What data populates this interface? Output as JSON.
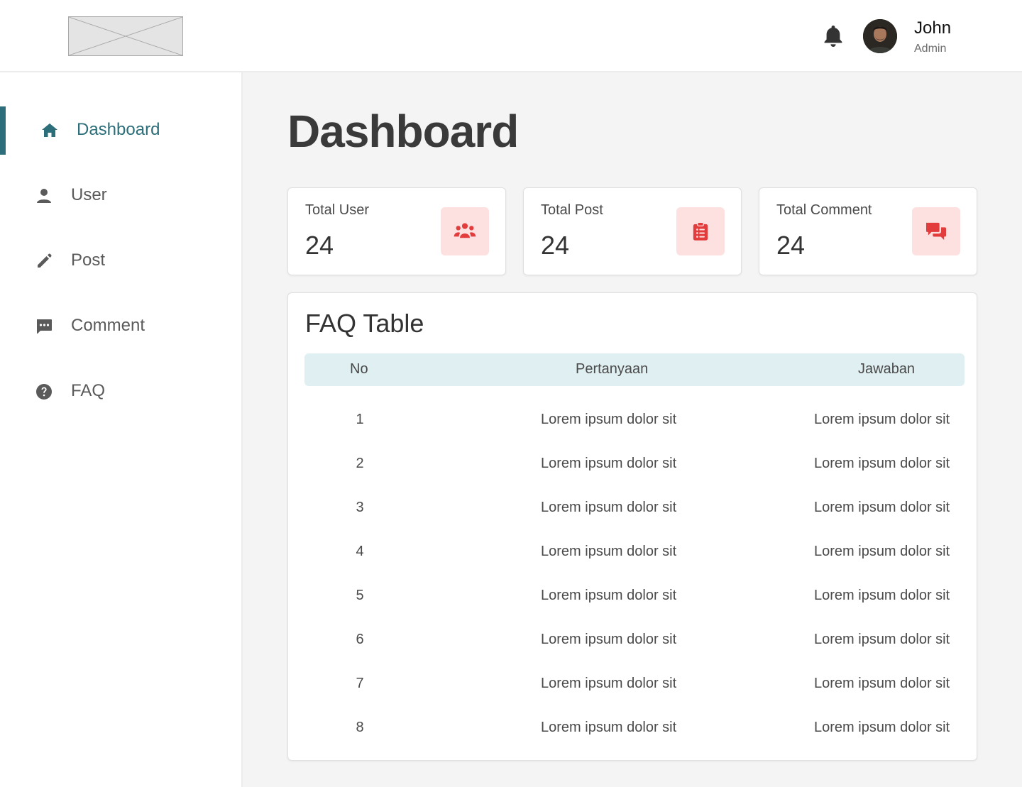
{
  "header": {
    "user_name": "John",
    "user_role": "Admin"
  },
  "sidebar": {
    "items": [
      {
        "label": "Dashboard",
        "icon": "home-icon",
        "active": true
      },
      {
        "label": "User",
        "icon": "person-icon",
        "active": false
      },
      {
        "label": "Post",
        "icon": "pencil-icon",
        "active": false
      },
      {
        "label": "Comment",
        "icon": "comment-icon",
        "active": false
      },
      {
        "label": "FAQ",
        "icon": "question-circle-icon",
        "active": false
      }
    ]
  },
  "main": {
    "title": "Dashboard",
    "cards": [
      {
        "label": "Total User",
        "value": "24",
        "icon": "users-group-icon"
      },
      {
        "label": "Total Post",
        "value": "24",
        "icon": "clipboard-list-icon"
      },
      {
        "label": "Total Comment",
        "value": "24",
        "icon": "comments-icon"
      }
    ],
    "faq": {
      "title": "FAQ Table",
      "columns": [
        "No",
        "Pertanyaan",
        "Jawaban"
      ],
      "rows": [
        {
          "no": "1",
          "q": "Lorem ipsum dolor sit",
          "a": "Lorem ipsum dolor sit"
        },
        {
          "no": "2",
          "q": "Lorem ipsum dolor sit",
          "a": "Lorem ipsum dolor sit"
        },
        {
          "no": "3",
          "q": "Lorem ipsum dolor sit",
          "a": "Lorem ipsum dolor sit"
        },
        {
          "no": "4",
          "q": "Lorem ipsum dolor sit",
          "a": "Lorem ipsum dolor sit"
        },
        {
          "no": "5",
          "q": "Lorem ipsum dolor sit",
          "a": "Lorem ipsum dolor sit"
        },
        {
          "no": "6",
          "q": "Lorem ipsum dolor sit",
          "a": "Lorem ipsum dolor sit"
        },
        {
          "no": "7",
          "q": "Lorem ipsum dolor sit",
          "a": "Lorem ipsum dolor sit"
        },
        {
          "no": "8",
          "q": "Lorem ipsum dolor sit",
          "a": "Lorem ipsum dolor sit"
        }
      ]
    }
  },
  "colors": {
    "accent": "#2c6e7a",
    "card_icon_bg": "#fde1e1",
    "card_icon_fg": "#e23c3c",
    "table_header_bg": "#e0eff2",
    "main_bg": "#f4f4f4"
  }
}
